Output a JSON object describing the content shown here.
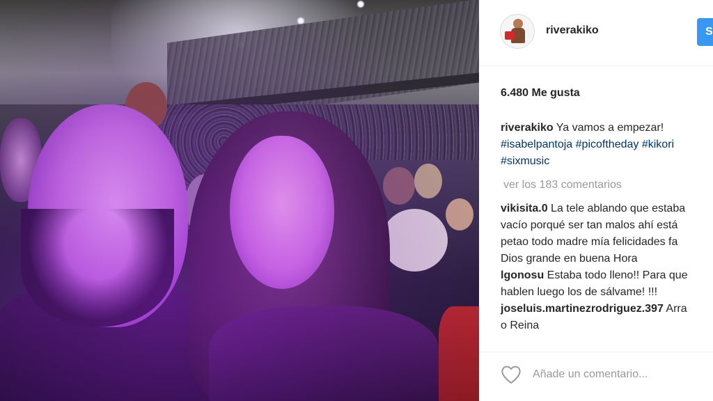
{
  "post": {
    "username": "riverakiko",
    "follow_label": "S",
    "likes": "6.480 Me gusta",
    "caption": {
      "username": "riverakiko",
      "text": " Ya vamos a empezar!",
      "hashtags_line1": [
        "#isabelpantoja",
        "#picoftheday",
        "#kikori"
      ],
      "hashtags_line2": [
        "#sixmusic"
      ]
    },
    "view_all_comments": "ver los 183 comentarios",
    "comments": [
      {
        "username": "vikisita.0",
        "lines": [
          " La tele ablando que estaba",
          "vacío porqué ser tan malos ahí está",
          "petao todo madre mía felicidades fa",
          "Dios grande en buena Hora"
        ]
      },
      {
        "username": "lgonosu",
        "lines": [
          " Estaba todo lleno!! Para que",
          "hablen luego los de sálvame! !!!"
        ]
      },
      {
        "username": "joseluis.martinezrodriguez.397",
        "lines": [
          " Arra",
          "o Reina"
        ]
      }
    ],
    "add_comment_placeholder": "Añade un comentario..."
  },
  "icons": {
    "like": "heart-icon"
  },
  "colors": {
    "follow_button": "#3897f0",
    "hashtag": "#003569",
    "muted_text": "#999999"
  }
}
